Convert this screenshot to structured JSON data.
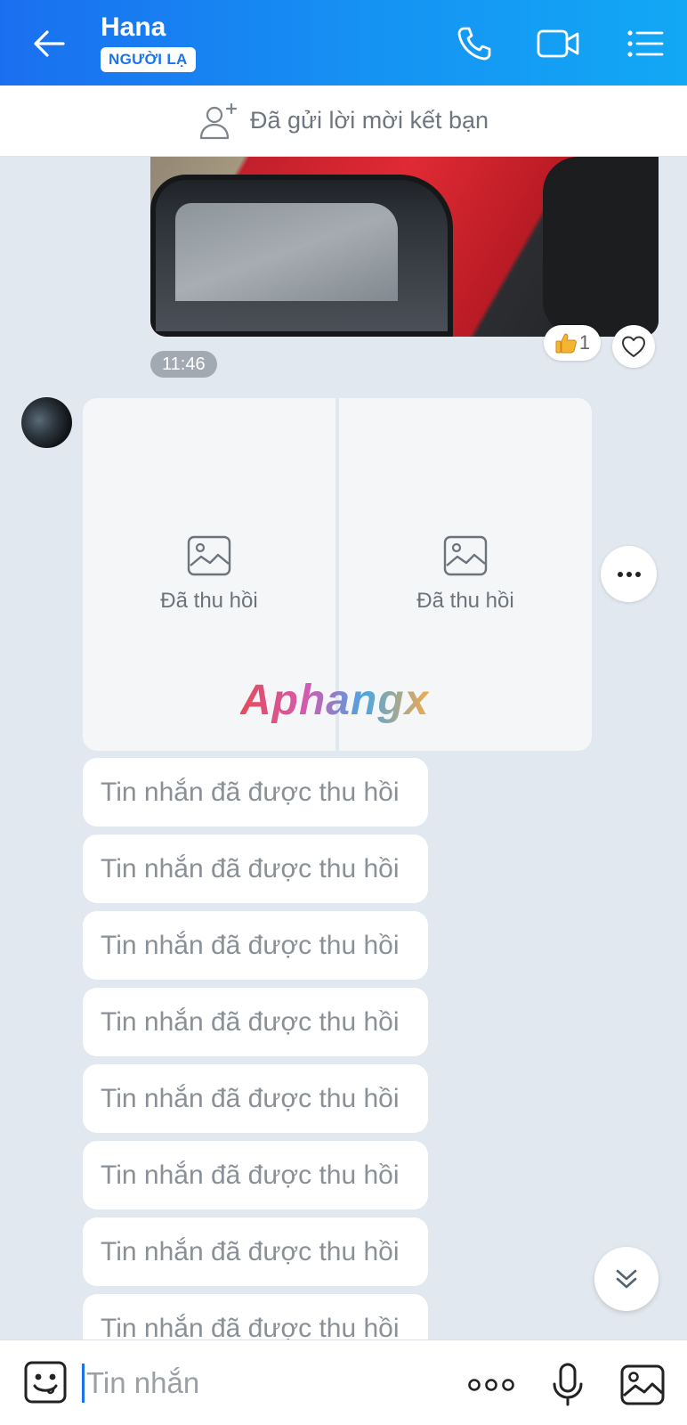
{
  "header": {
    "title": "Hana",
    "badge": "NGƯỜI LẠ"
  },
  "friend_request": {
    "text": "Đã gửi lời mời kết bạn"
  },
  "photo_message": {
    "reaction_count": "1",
    "time": "11:46"
  },
  "recalled_images": [
    {
      "label": "Đã thu hồi"
    },
    {
      "label": "Đã thu hồi"
    }
  ],
  "watermark": "Aphangx",
  "recalled_messages": [
    "Tin nhắn đã được thu hồi",
    "Tin nhắn đã được thu hồi",
    "Tin nhắn đã được thu hồi",
    "Tin nhắn đã được thu hồi",
    "Tin nhắn đã được thu hồi",
    "Tin nhắn đã được thu hồi",
    "Tin nhắn đã được thu hồi",
    "Tin nhắn đã được thu hồi"
  ],
  "composer": {
    "placeholder": "Tin nhắn"
  },
  "colors": {
    "header_gradient_start": "#1a6ff0",
    "header_gradient_end": "#12a8f5",
    "chat_bg": "#e2e8ef"
  },
  "icons": {
    "back": "arrow-left-icon",
    "call": "phone-icon",
    "video": "video-camera-icon",
    "menu": "list-menu-icon",
    "add_friend": "user-plus-icon",
    "like": "thumbs-up-icon",
    "heart": "heart-icon",
    "image_placeholder": "image-icon",
    "more": "more-horizontal-icon",
    "scroll_down": "double-chevron-down-icon",
    "emoji": "sticker-icon",
    "composer_more": "ellipsis-icon",
    "mic": "microphone-icon",
    "gallery": "gallery-icon"
  }
}
